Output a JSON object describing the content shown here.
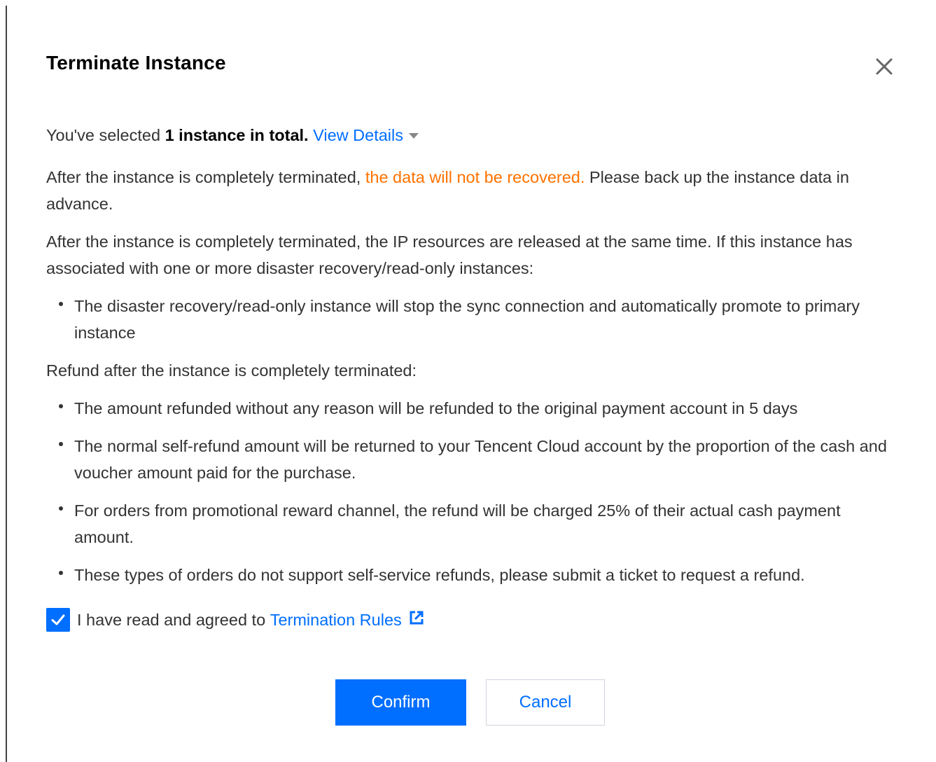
{
  "dialog": {
    "title": "Terminate Instance",
    "close_icon": "close-icon"
  },
  "selection": {
    "prefix": "You've selected ",
    "count_text": "1 instance in total.",
    "details_link": "View Details"
  },
  "warning": {
    "prefix": "After the instance is completely terminated, ",
    "highlight": "the data will not be recovered.",
    "suffix": " Please back up the instance data in advance."
  },
  "ip_notice": {
    "text": "After the instance is completely terminated, the IP resources are released at the same time. If this instance has associated with one or more disaster recovery/read-only instances:",
    "bullets": [
      "The disaster recovery/read-only instance will stop the sync connection and automatically promote to primary instance"
    ]
  },
  "refund": {
    "heading": "Refund after the instance is completely terminated:",
    "bullets": [
      "The amount refunded without any reason will be refunded to the original payment account in 5 days",
      "The normal self-refund amount will be returned to your Tencent Cloud account by the proportion of the cash and voucher amount paid for the purchase.",
      "For orders from promotional reward channel, the refund will be charged 25% of their actual cash payment amount.",
      "These types of orders do not support self-service refunds, please submit a ticket to request a refund."
    ]
  },
  "agreement": {
    "checked": true,
    "label": "I have read and agreed to ",
    "link": "Termination Rules",
    "link_icon": "external-link-icon"
  },
  "buttons": {
    "confirm": "Confirm",
    "cancel": "Cancel"
  },
  "colors": {
    "primary": "#006eff",
    "warning": "#ff7200",
    "text": "#333333"
  }
}
